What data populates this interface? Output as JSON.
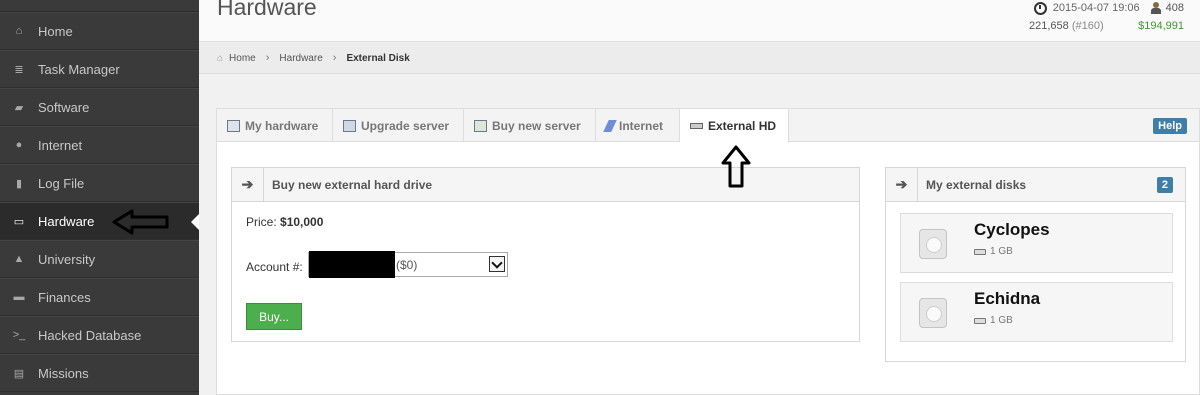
{
  "sidebar": {
    "items": [
      {
        "label": "Home",
        "icon": "home-icon"
      },
      {
        "label": "Task Manager",
        "icon": "tasks-icon"
      },
      {
        "label": "Software",
        "icon": "folder-icon"
      },
      {
        "label": "Internet",
        "icon": "globe-icon"
      },
      {
        "label": "Log File",
        "icon": "book-icon"
      },
      {
        "label": "Hardware",
        "icon": "monitor-icon",
        "active": true
      },
      {
        "label": "University",
        "icon": "flask-icon"
      },
      {
        "label": "Finances",
        "icon": "briefcase-icon"
      },
      {
        "label": "Hacked Database",
        "icon": "terminal-icon"
      },
      {
        "label": "Missions",
        "icon": "clipboard-icon"
      }
    ]
  },
  "header": {
    "title": "Hardware",
    "datetime": "2015-04-07 19:06",
    "online": "408",
    "reputation": "221,658",
    "rank": "(#160)",
    "money": "$194,991"
  },
  "breadcrumb": [
    "Home",
    "Hardware",
    "External Disk"
  ],
  "tabs": [
    {
      "label": "My hardware",
      "icon": "hardware-icon"
    },
    {
      "label": "Upgrade server",
      "icon": "upgrade-icon"
    },
    {
      "label": "Buy new server",
      "icon": "add-server-icon"
    },
    {
      "label": "Internet",
      "icon": "cable-icon"
    },
    {
      "label": "External HD",
      "icon": "hd-icon",
      "active": true
    }
  ],
  "help_label": "Help",
  "buy_panel": {
    "title": "Buy new external hard drive",
    "price_label": "Price:",
    "price_value": "$10,000",
    "account_label": "Account #:",
    "account_value": "($0)",
    "buy_label": "Buy..."
  },
  "disks_panel": {
    "title": "My external disks",
    "count": "2",
    "disks": [
      {
        "name": "Cyclopes",
        "size": "1 GB"
      },
      {
        "name": "Echidna",
        "size": "1 GB"
      }
    ]
  },
  "colors": {
    "sidebar_bg": "#3a3a3a",
    "accent_blue": "#3d7fa6",
    "buy_green": "#4cae4c",
    "money_green": "#3a9a2a"
  }
}
